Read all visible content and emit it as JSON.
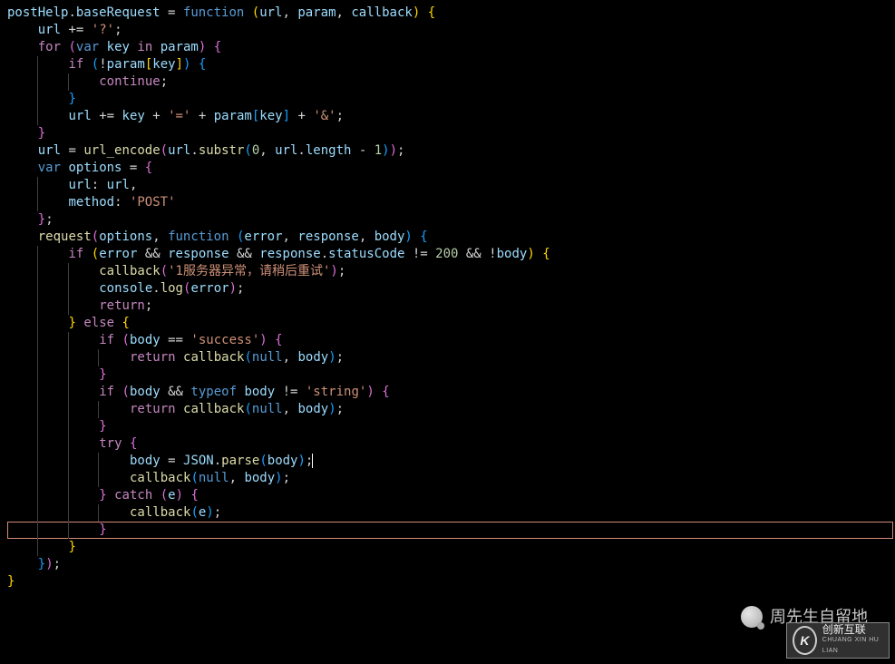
{
  "code_lines": [
    [
      [
        "id",
        "postHelp"
      ],
      [
        "op",
        "."
      ],
      [
        "id",
        "baseRequest"
      ],
      [
        "op",
        " = "
      ],
      [
        "kw2",
        "function"
      ],
      [
        "op",
        " "
      ],
      [
        "pbrace",
        "("
      ],
      [
        "id",
        "url"
      ],
      [
        "op",
        ", "
      ],
      [
        "id",
        "param"
      ],
      [
        "op",
        ", "
      ],
      [
        "id",
        "callback"
      ],
      [
        "pbrace",
        ")"
      ],
      [
        "op",
        " "
      ],
      [
        "pbrace",
        "{"
      ]
    ],
    [
      [
        "ws",
        "    "
      ],
      [
        "id",
        "url"
      ],
      [
        "op",
        " += "
      ],
      [
        "str",
        "'?'"
      ],
      [
        "op",
        ";"
      ]
    ],
    [
      [
        "ws",
        ""
      ]
    ],
    [
      [
        "ws",
        "    "
      ],
      [
        "kw",
        "for"
      ],
      [
        "op",
        " "
      ],
      [
        "pbrace2",
        "("
      ],
      [
        "kw2",
        "var"
      ],
      [
        "op",
        " "
      ],
      [
        "id",
        "key"
      ],
      [
        "op",
        " "
      ],
      [
        "kw",
        "in"
      ],
      [
        "op",
        " "
      ],
      [
        "id",
        "param"
      ],
      [
        "pbrace2",
        ")"
      ],
      [
        "op",
        " "
      ],
      [
        "pbrace2",
        "{"
      ]
    ],
    [
      [
        "ws",
        "        "
      ],
      [
        "kw",
        "if"
      ],
      [
        "op",
        " "
      ],
      [
        "pbrace3",
        "("
      ],
      [
        "op",
        "!"
      ],
      [
        "id",
        "param"
      ],
      [
        "pbrace",
        "["
      ],
      [
        "id",
        "key"
      ],
      [
        "pbrace",
        "]"
      ],
      [
        "pbrace3",
        ")"
      ],
      [
        "op",
        " "
      ],
      [
        "pbrace3",
        "{"
      ]
    ],
    [
      [
        "ws",
        "            "
      ],
      [
        "kw",
        "continue"
      ],
      [
        "op",
        ";"
      ]
    ],
    [
      [
        "ws",
        "        "
      ],
      [
        "pbrace3",
        "}"
      ]
    ],
    [
      [
        "ws",
        "        "
      ],
      [
        "id",
        "url"
      ],
      [
        "op",
        " += "
      ],
      [
        "id",
        "key"
      ],
      [
        "op",
        " + "
      ],
      [
        "str",
        "'='"
      ],
      [
        "op",
        " + "
      ],
      [
        "id",
        "param"
      ],
      [
        "pbrace3",
        "["
      ],
      [
        "id",
        "key"
      ],
      [
        "pbrace3",
        "]"
      ],
      [
        "op",
        " + "
      ],
      [
        "str",
        "'&'"
      ],
      [
        "op",
        ";"
      ]
    ],
    [
      [
        "ws",
        "    "
      ],
      [
        "pbrace2",
        "}"
      ]
    ],
    [
      [
        "ws",
        "    "
      ],
      [
        "id",
        "url"
      ],
      [
        "op",
        " = "
      ],
      [
        "fn",
        "url_encode"
      ],
      [
        "pbrace2",
        "("
      ],
      [
        "id",
        "url"
      ],
      [
        "op",
        "."
      ],
      [
        "fn",
        "substr"
      ],
      [
        "pbrace3",
        "("
      ],
      [
        "num",
        "0"
      ],
      [
        "op",
        ", "
      ],
      [
        "id",
        "url"
      ],
      [
        "op",
        "."
      ],
      [
        "id",
        "length"
      ],
      [
        "op",
        " - "
      ],
      [
        "num",
        "1"
      ],
      [
        "pbrace3",
        ")"
      ],
      [
        "pbrace2",
        ")"
      ],
      [
        "op",
        ";"
      ]
    ],
    [
      [
        "ws",
        ""
      ]
    ],
    [
      [
        "ws",
        "    "
      ],
      [
        "kw2",
        "var"
      ],
      [
        "op",
        " "
      ],
      [
        "id",
        "options"
      ],
      [
        "op",
        " = "
      ],
      [
        "pbrace2",
        "{"
      ]
    ],
    [
      [
        "ws",
        "        "
      ],
      [
        "id",
        "url"
      ],
      [
        "op",
        ": "
      ],
      [
        "id",
        "url"
      ],
      [
        "op",
        ","
      ]
    ],
    [
      [
        "ws",
        "        "
      ],
      [
        "id",
        "method"
      ],
      [
        "op",
        ": "
      ],
      [
        "str",
        "'POST'"
      ]
    ],
    [
      [
        "ws",
        "    "
      ],
      [
        "pbrace2",
        "}"
      ],
      [
        "op",
        ";"
      ]
    ],
    [
      [
        "ws",
        ""
      ]
    ],
    [
      [
        "ws",
        "    "
      ],
      [
        "fn",
        "request"
      ],
      [
        "pbrace2",
        "("
      ],
      [
        "id",
        "options"
      ],
      [
        "op",
        ", "
      ],
      [
        "kw2",
        "function"
      ],
      [
        "op",
        " "
      ],
      [
        "pbrace3",
        "("
      ],
      [
        "id",
        "error"
      ],
      [
        "op",
        ", "
      ],
      [
        "id",
        "response"
      ],
      [
        "op",
        ", "
      ],
      [
        "id",
        "body"
      ],
      [
        "pbrace3",
        ")"
      ],
      [
        "op",
        " "
      ],
      [
        "pbrace3",
        "{"
      ]
    ],
    [
      [
        "ws",
        ""
      ]
    ],
    [
      [
        "ws",
        "        "
      ],
      [
        "kw",
        "if"
      ],
      [
        "op",
        " "
      ],
      [
        "pbrace",
        "("
      ],
      [
        "id",
        "error"
      ],
      [
        "op",
        " && "
      ],
      [
        "id",
        "response"
      ],
      [
        "op",
        " && "
      ],
      [
        "id",
        "response"
      ],
      [
        "op",
        "."
      ],
      [
        "id",
        "statusCode"
      ],
      [
        "op",
        " != "
      ],
      [
        "num",
        "200"
      ],
      [
        "op",
        " && !"
      ],
      [
        "id",
        "body"
      ],
      [
        "pbrace",
        ")"
      ],
      [
        "op",
        " "
      ],
      [
        "pbrace",
        "{"
      ]
    ],
    [
      [
        "ws",
        "            "
      ],
      [
        "fn",
        "callback"
      ],
      [
        "pbrace2",
        "("
      ],
      [
        "str",
        "'1服务器异常，请稍后重试'"
      ],
      [
        "pbrace2",
        ")"
      ],
      [
        "op",
        ";"
      ]
    ],
    [
      [
        "ws",
        "            "
      ],
      [
        "id",
        "console"
      ],
      [
        "op",
        "."
      ],
      [
        "fn",
        "log"
      ],
      [
        "pbrace2",
        "("
      ],
      [
        "id",
        "error"
      ],
      [
        "pbrace2",
        ")"
      ],
      [
        "op",
        ";"
      ]
    ],
    [
      [
        "ws",
        "            "
      ],
      [
        "kw",
        "return"
      ],
      [
        "op",
        ";"
      ]
    ],
    [
      [
        "ws",
        "        "
      ],
      [
        "pbrace",
        "}"
      ],
      [
        "op",
        " "
      ],
      [
        "kw",
        "else"
      ],
      [
        "op",
        " "
      ],
      [
        "pbrace",
        "{"
      ]
    ],
    [
      [
        "ws",
        "            "
      ],
      [
        "kw",
        "if"
      ],
      [
        "op",
        " "
      ],
      [
        "pbrace2",
        "("
      ],
      [
        "id",
        "body"
      ],
      [
        "op",
        " == "
      ],
      [
        "str",
        "'success'"
      ],
      [
        "pbrace2",
        ")"
      ],
      [
        "op",
        " "
      ],
      [
        "pbrace2",
        "{"
      ]
    ],
    [
      [
        "ws",
        "                "
      ],
      [
        "kw",
        "return"
      ],
      [
        "op",
        " "
      ],
      [
        "fn",
        "callback"
      ],
      [
        "pbrace3",
        "("
      ],
      [
        "nil",
        "null"
      ],
      [
        "op",
        ", "
      ],
      [
        "id",
        "body"
      ],
      [
        "pbrace3",
        ")"
      ],
      [
        "op",
        ";"
      ]
    ],
    [
      [
        "ws",
        "            "
      ],
      [
        "pbrace2",
        "}"
      ]
    ],
    [
      [
        "ws",
        "            "
      ],
      [
        "kw",
        "if"
      ],
      [
        "op",
        " "
      ],
      [
        "pbrace2",
        "("
      ],
      [
        "id",
        "body"
      ],
      [
        "op",
        " && "
      ],
      [
        "kw2",
        "typeof"
      ],
      [
        "op",
        " "
      ],
      [
        "id",
        "body"
      ],
      [
        "op",
        " != "
      ],
      [
        "str",
        "'string'"
      ],
      [
        "pbrace2",
        ")"
      ],
      [
        "op",
        " "
      ],
      [
        "pbrace2",
        "{"
      ]
    ],
    [
      [
        "ws",
        "                "
      ],
      [
        "kw",
        "return"
      ],
      [
        "op",
        " "
      ],
      [
        "fn",
        "callback"
      ],
      [
        "pbrace3",
        "("
      ],
      [
        "nil",
        "null"
      ],
      [
        "op",
        ", "
      ],
      [
        "id",
        "body"
      ],
      [
        "pbrace3",
        ")"
      ],
      [
        "op",
        ";"
      ]
    ],
    [
      [
        "ws",
        "            "
      ],
      [
        "pbrace2",
        "}"
      ]
    ],
    [
      [
        "ws",
        "            "
      ],
      [
        "kw",
        "try"
      ],
      [
        "op",
        " "
      ],
      [
        "pbrace2",
        "{"
      ]
    ],
    [
      [
        "ws",
        "                "
      ],
      [
        "id",
        "body"
      ],
      [
        "op",
        " = "
      ],
      [
        "id",
        "JSON"
      ],
      [
        "op",
        "."
      ],
      [
        "fn",
        "parse"
      ],
      [
        "pbrace3",
        "("
      ],
      [
        "id",
        "body"
      ],
      [
        "pbrace3",
        ")"
      ],
      [
        "op",
        ";"
      ],
      [
        "cursor",
        ""
      ]
    ],
    [
      [
        "ws",
        "                "
      ],
      [
        "fn",
        "callback"
      ],
      [
        "pbrace3",
        "("
      ],
      [
        "nil",
        "null"
      ],
      [
        "op",
        ", "
      ],
      [
        "id",
        "body"
      ],
      [
        "pbrace3",
        ")"
      ],
      [
        "op",
        ";"
      ]
    ],
    [
      [
        "ws",
        "            "
      ],
      [
        "pbrace2",
        "}"
      ],
      [
        "op",
        " "
      ],
      [
        "kw",
        "catch"
      ],
      [
        "op",
        " "
      ],
      [
        "pbrace2",
        "("
      ],
      [
        "id",
        "e"
      ],
      [
        "pbrace2",
        ")"
      ],
      [
        "op",
        " "
      ],
      [
        "pbrace2",
        "{"
      ]
    ],
    [
      [
        "ws",
        "                "
      ],
      [
        "fn",
        "callback"
      ],
      [
        "pbrace3",
        "("
      ],
      [
        "id",
        "e"
      ],
      [
        "pbrace3",
        ")"
      ],
      [
        "op",
        ";"
      ]
    ],
    [
      [
        "ws",
        "            "
      ],
      [
        "pbrace2",
        "}"
      ]
    ],
    [
      [
        "ws",
        "        "
      ],
      [
        "pbrace",
        "}"
      ]
    ],
    [
      [
        "ws",
        "    "
      ],
      [
        "pbrace3",
        "}"
      ],
      [
        "pbrace2",
        ")"
      ],
      [
        "op",
        ";"
      ]
    ],
    [
      [
        "pbrace",
        "}"
      ]
    ]
  ],
  "highlight_line_index": 30,
  "watermark1_text": "周先生自留地",
  "watermark2_brand": "创新互联",
  "watermark2_sub": "CHUANG XIN HU LIAN",
  "watermark2_logo": "K"
}
